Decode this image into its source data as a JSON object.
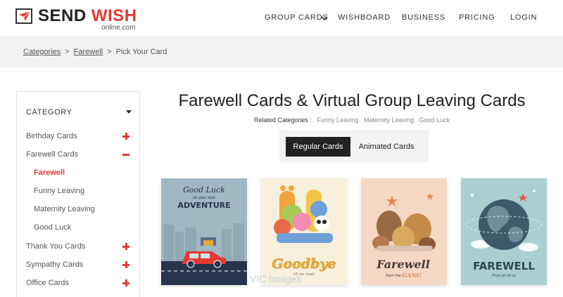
{
  "brand": {
    "word1": "SEND",
    "word2": "WISH",
    "sub": "online.com",
    "accent": "#e53935"
  },
  "nav": {
    "group_cards": "GROUP CARDS",
    "wishboard": "WISHBOARD",
    "business": "BUSINESS",
    "pricing": "PRICING",
    "login": "LOGIN"
  },
  "breadcrumb": {
    "categories": "Categories",
    "farewell": "Farewell",
    "current": "Pick Your Card",
    "separator": ">"
  },
  "sidebar": {
    "heading": "CATEGORY",
    "items": [
      {
        "label": "Birthday Cards",
        "toggle": "plus"
      },
      {
        "label": "Farewell Cards",
        "toggle": "minus"
      },
      {
        "label": "Farewell",
        "sub": true,
        "active": true
      },
      {
        "label": "Funny Leaving",
        "sub": true
      },
      {
        "label": "Maternity Leaving",
        "sub": true
      },
      {
        "label": "Good Luck",
        "sub": true
      },
      {
        "label": "Thank You Cards",
        "toggle": "plus"
      },
      {
        "label": "Sympathy Cards",
        "toggle": "plus"
      },
      {
        "label": "Office Cards",
        "toggle": "plus"
      }
    ]
  },
  "main": {
    "title": "Farewell Cards & Virtual Group Leaving Cards",
    "related_label": "Related Categories :",
    "related": [
      "Funny Leaving",
      "Maternity Leaving",
      "Good Luck"
    ],
    "tabs": [
      "Regular Cards",
      "Animated Cards"
    ]
  },
  "cards": [
    {
      "top_script": "Good Luck",
      "small": "on your next",
      "title": "ADVENTURE"
    },
    {
      "title": "Goodbye",
      "small": "till we meet"
    },
    {
      "title": "Farewell",
      "small": "from the",
      "gang": "GANG"
    },
    {
      "title": "FAREWELL",
      "small": "From all of us"
    }
  ],
  "watermark": "VIC Images"
}
